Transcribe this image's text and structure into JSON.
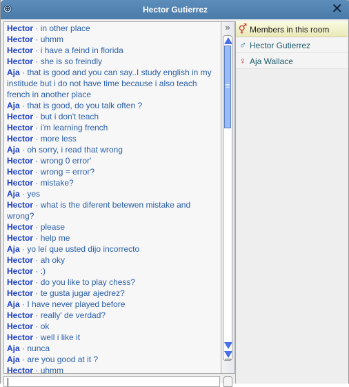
{
  "window": {
    "title": "Hector Gutierrez",
    "expand_icon": "⊕",
    "close_icon": "✕"
  },
  "chat": {
    "separator": " · ",
    "messages": [
      {
        "sender": "Hector",
        "text": "in other place"
      },
      {
        "sender": "Hector",
        "text": "uhmm"
      },
      {
        "sender": "Hector",
        "text": "i have a feind in florida"
      },
      {
        "sender": "Hector",
        "text": "she is so freindly"
      },
      {
        "sender": "Aja",
        "text": "that is good and you can say..I study english in my institude but i do not have time because i also teach french in another place"
      },
      {
        "sender": "Aja",
        "text": "that is good, do you talk often ?"
      },
      {
        "sender": "Hector",
        "text": "but i don't teach"
      },
      {
        "sender": "Hector",
        "text": "i'm learning french"
      },
      {
        "sender": "Hector",
        "text": "more less"
      },
      {
        "sender": "Aja",
        "text": "oh sorry, i read that wrong"
      },
      {
        "sender": "Hector",
        "text": "wrong 0 error'"
      },
      {
        "sender": "Hector",
        "text": "wrong = error?"
      },
      {
        "sender": "Hector",
        "text": "mistake?"
      },
      {
        "sender": "Aja",
        "text": "yes"
      },
      {
        "sender": "Hector",
        "text": "what is the diferent betewen mistake and wrong?"
      },
      {
        "sender": "Hector",
        "text": "please"
      },
      {
        "sender": "Hector",
        "text": "help me"
      },
      {
        "sender": "Aja",
        "text": "yo leí que usted dijo incorrecto"
      },
      {
        "sender": "Hector",
        "text": "ah oky"
      },
      {
        "sender": "Hector",
        "text": ":)"
      },
      {
        "sender": "Hector",
        "text": "do you like to play chess?"
      },
      {
        "sender": "Hector",
        "text": "te gusta jugar ajedrez?"
      },
      {
        "sender": "Aja",
        "text": "I have never played before"
      },
      {
        "sender": "Hector",
        "text": "really' de verdad?"
      },
      {
        "sender": "Hector",
        "text": "ok"
      },
      {
        "sender": "Hector",
        "text": "well i like it"
      },
      {
        "sender": "Aja",
        "text": "nunca"
      },
      {
        "sender": "Aja",
        "text": "are you good at it ?"
      },
      {
        "sender": "Hector",
        "text": "uhmm"
      }
    ]
  },
  "scrollbar": {
    "collapse_icon": "»"
  },
  "members": {
    "header": "Members in this room",
    "header_icon": "⚥",
    "list": [
      {
        "name": "Hector Gutierrez",
        "gender_icon": "♂",
        "gender": "male"
      },
      {
        "name": "Aja Wallace",
        "gender_icon": "♀",
        "gender": "female"
      }
    ]
  },
  "input": {
    "value": "",
    "placeholder": ""
  }
}
